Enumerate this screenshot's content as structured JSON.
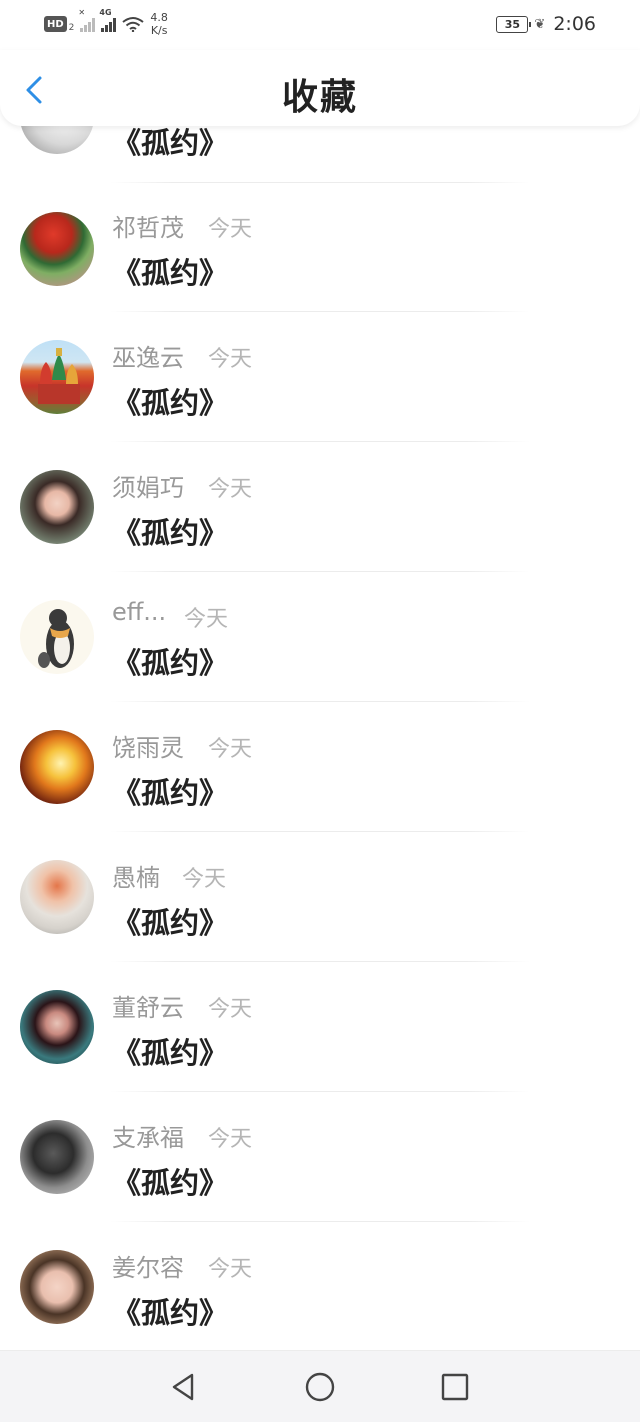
{
  "status_bar": {
    "hd_badge": "HD",
    "hd_sub": "2",
    "network": "4G",
    "speed_value": "4.8",
    "speed_unit": "K/s",
    "battery": "35",
    "time": "2:06"
  },
  "header": {
    "title": "收藏",
    "back_icon": "chevron-left-icon",
    "accent_color": "#2e8fe6"
  },
  "list": {
    "items": [
      {
        "name": "",
        "time": "",
        "message": "《孤约》"
      },
      {
        "name": "祁哲茂",
        "time": "今天",
        "message": "《孤约》"
      },
      {
        "name": "巫逸云",
        "time": "今天",
        "message": "《孤约》"
      },
      {
        "name": "须娟巧",
        "time": "今天",
        "message": "《孤约》"
      },
      {
        "name": "eff...",
        "time": "今天",
        "message": "《孤约》"
      },
      {
        "name": "饶雨灵",
        "time": "今天",
        "message": "《孤约》"
      },
      {
        "name": "愚楠",
        "time": "今天",
        "message": "《孤约》"
      },
      {
        "name": "董舒云",
        "time": "今天",
        "message": "《孤约》"
      },
      {
        "name": "支承福",
        "time": "今天",
        "message": "《孤约》"
      },
      {
        "name": "姜尔容",
        "time": "今天",
        "message": "《孤约》"
      }
    ]
  },
  "nav_bar": {
    "back_icon": "triangle-back-icon",
    "home_icon": "circle-home-icon",
    "recents_icon": "square-recents-icon"
  }
}
